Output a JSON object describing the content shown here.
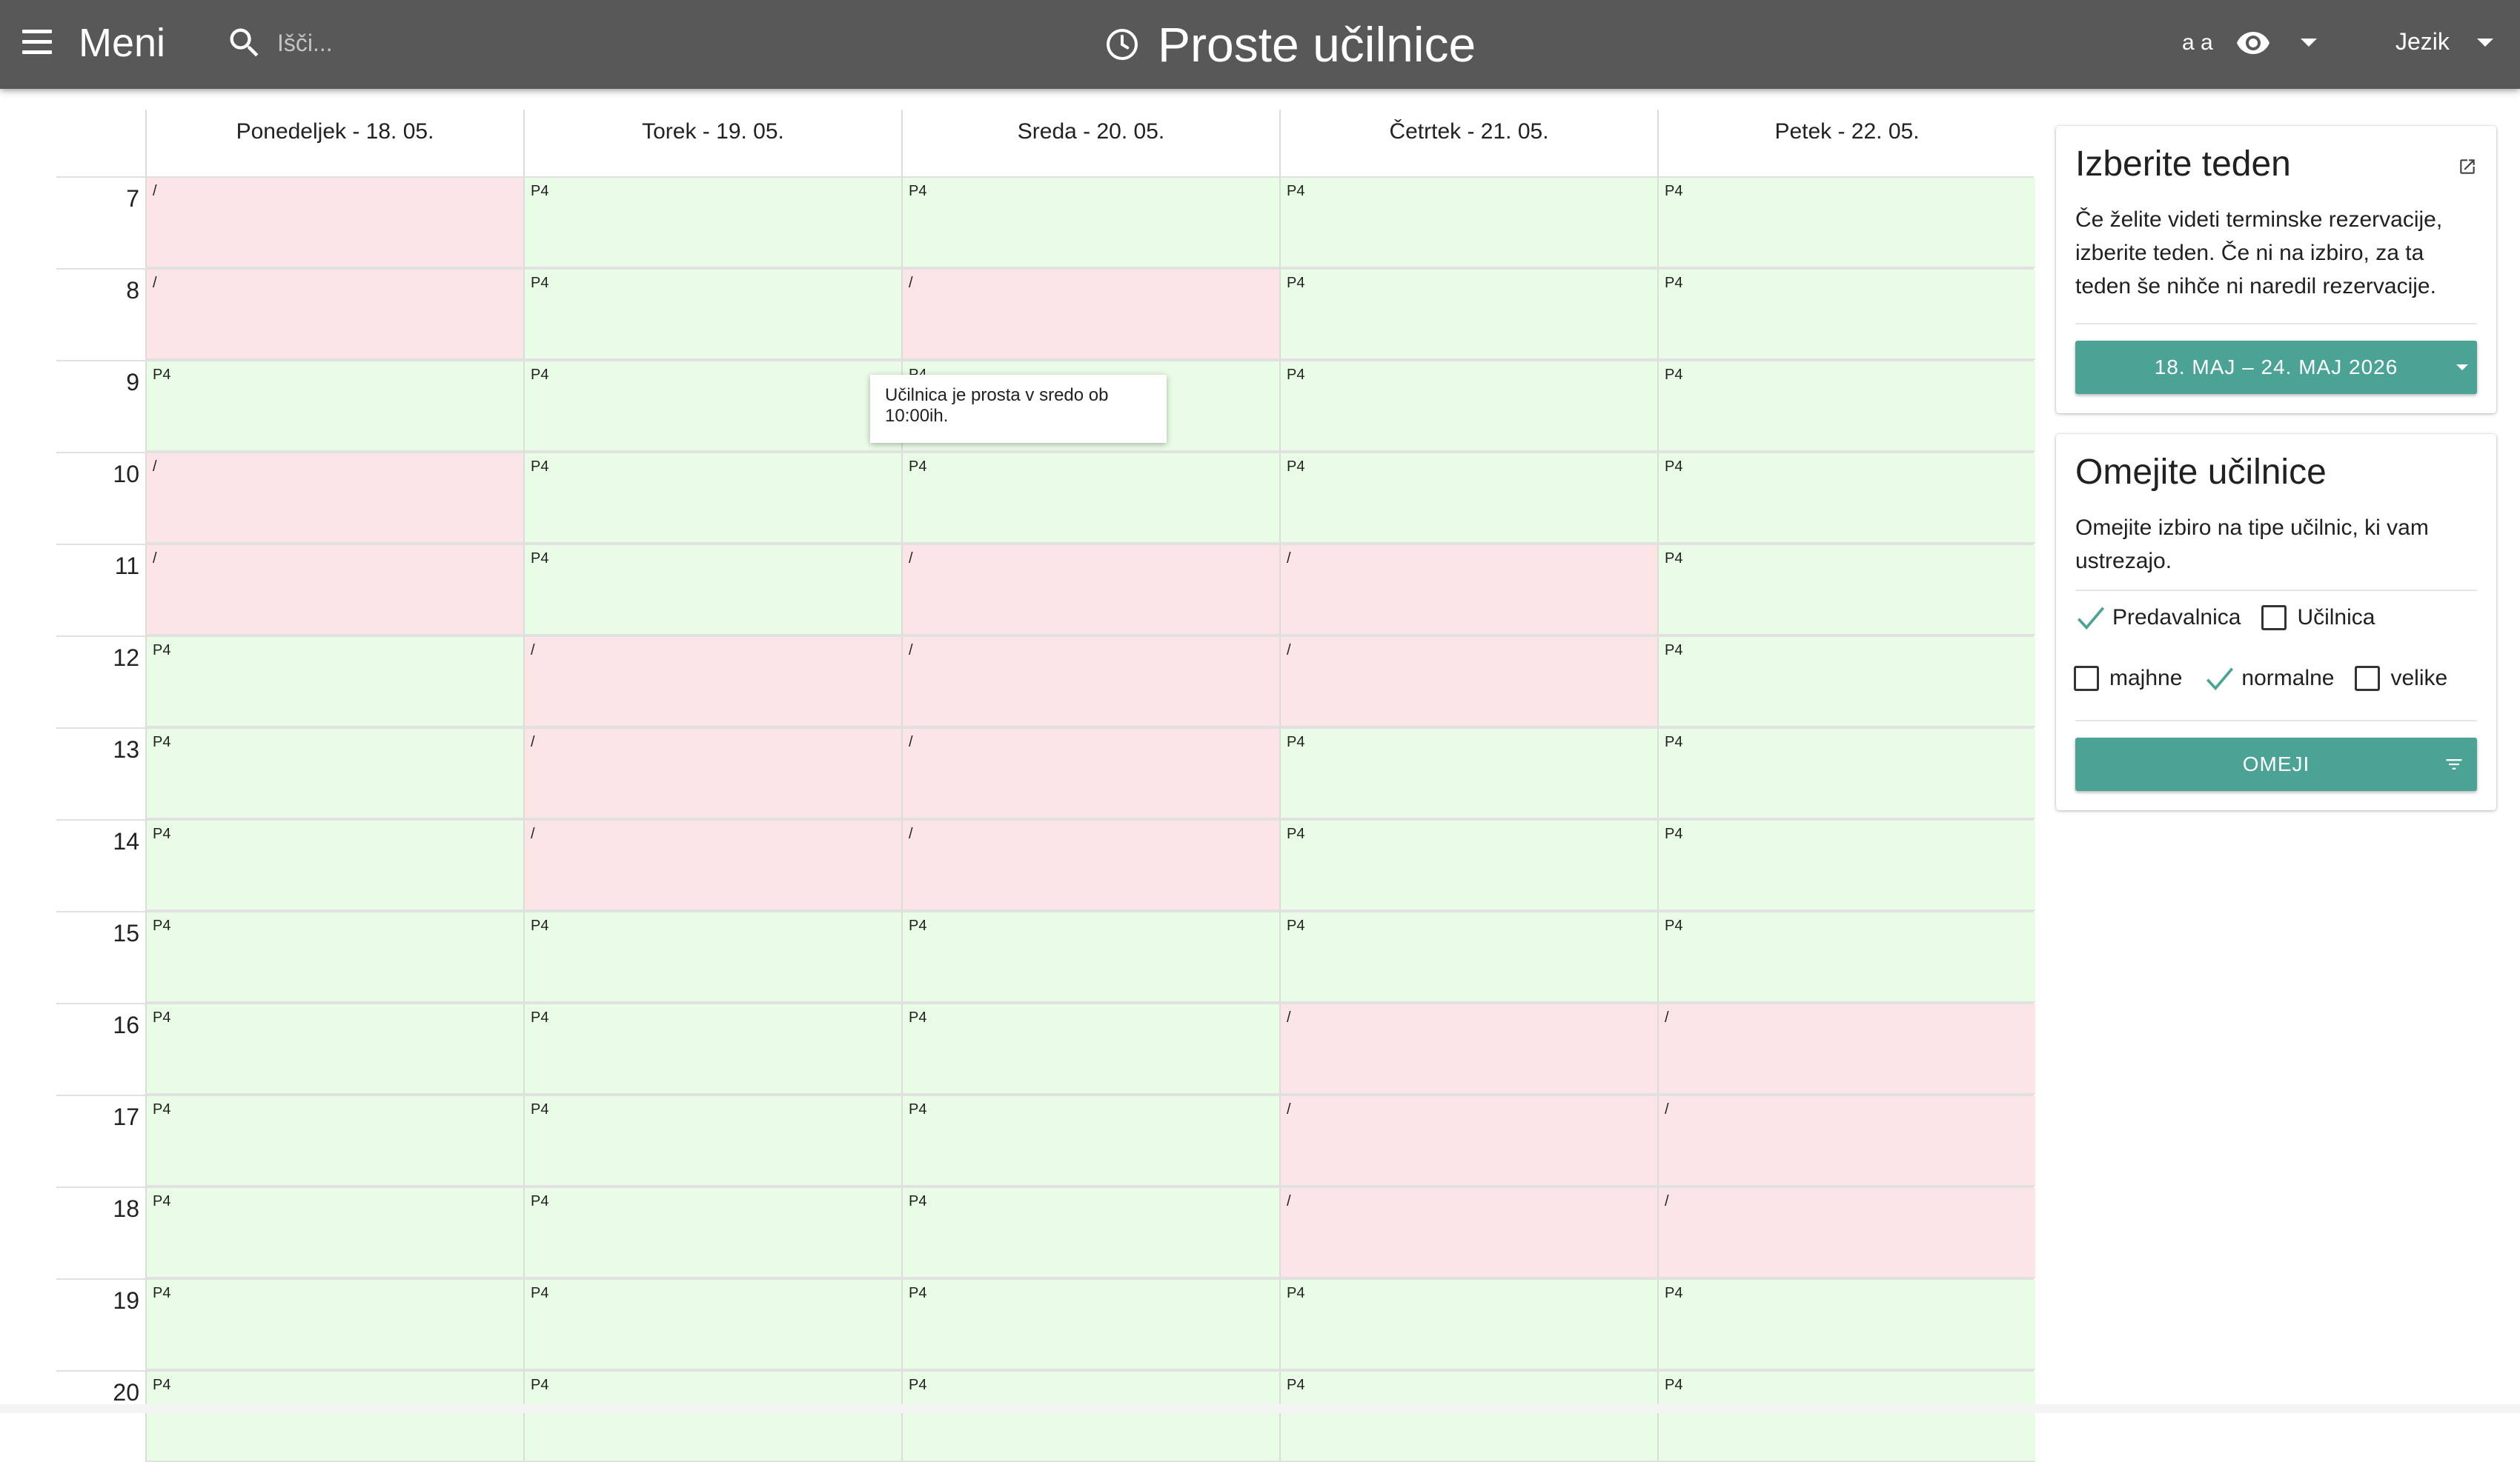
{
  "header": {
    "menu_label": "Meni",
    "search_placeholder": "Išči...",
    "title": "Proste učilnice",
    "font_size_label": "a a",
    "language_label": "Jezik"
  },
  "calendar": {
    "days": [
      "Ponedeljek - 18. 05.",
      "Torek - 19. 05.",
      "Sreda - 20. 05.",
      "Četrtek - 21. 05.",
      "Petek - 22. 05."
    ],
    "hours": [
      "7",
      "8",
      "9",
      "10",
      "11",
      "12",
      "13",
      "14",
      "15",
      "16",
      "17",
      "18",
      "19",
      "20"
    ],
    "free_label": "P4",
    "busy_label": "/",
    "availability": [
      [
        "busy",
        "free",
        "free",
        "free",
        "free"
      ],
      [
        "busy",
        "free",
        "busy",
        "free",
        "free"
      ],
      [
        "free",
        "free",
        "free",
        "free",
        "free"
      ],
      [
        "busy",
        "free",
        "free",
        "free",
        "free"
      ],
      [
        "busy",
        "free",
        "busy",
        "busy",
        "free"
      ],
      [
        "free",
        "busy",
        "busy",
        "busy",
        "free"
      ],
      [
        "free",
        "busy",
        "busy",
        "free",
        "free"
      ],
      [
        "free",
        "busy",
        "busy",
        "free",
        "free"
      ],
      [
        "free",
        "free",
        "free",
        "free",
        "free"
      ],
      [
        "free",
        "free",
        "free",
        "busy",
        "busy"
      ],
      [
        "free",
        "free",
        "free",
        "busy",
        "busy"
      ],
      [
        "free",
        "free",
        "free",
        "busy",
        "busy"
      ],
      [
        "free",
        "free",
        "free",
        "free",
        "free"
      ],
      [
        "free",
        "free",
        "free",
        "free",
        "free"
      ]
    ],
    "tooltip": "Učilnica je prosta v sredo ob 10:00ih."
  },
  "colors": {
    "free": "#e9fde6",
    "busy": "#fbe5e6",
    "accent": "#4aa394",
    "topbar": "#585858"
  },
  "week_card": {
    "title": "Izberite teden",
    "description": "Če želite videti terminske rezervacije, izberite teden. Če ni na izbiro, za ta teden še nihče ni naredil rezervacije.",
    "week_button": "18. MAJ – 24. MAJ 2026"
  },
  "filter_card": {
    "title": "Omejite učilnice",
    "description": "Omejite izbiro na tipe učilnic, ki vam ustrezajo.",
    "type_options": [
      {
        "label": "Predavalnica",
        "checked": true
      },
      {
        "label": "Učilnica",
        "checked": false
      }
    ],
    "size_options": [
      {
        "label": "majhne",
        "checked": false
      },
      {
        "label": "normalne",
        "checked": true
      },
      {
        "label": "velike",
        "checked": false
      }
    ],
    "apply_button": "OMEJI"
  },
  "icons": {
    "menu": "hamburger-icon",
    "search": "search-icon",
    "title": "clock-icon",
    "visibility": "eye-icon",
    "open": "open-in-new-icon",
    "filter": "filter-list-icon"
  }
}
